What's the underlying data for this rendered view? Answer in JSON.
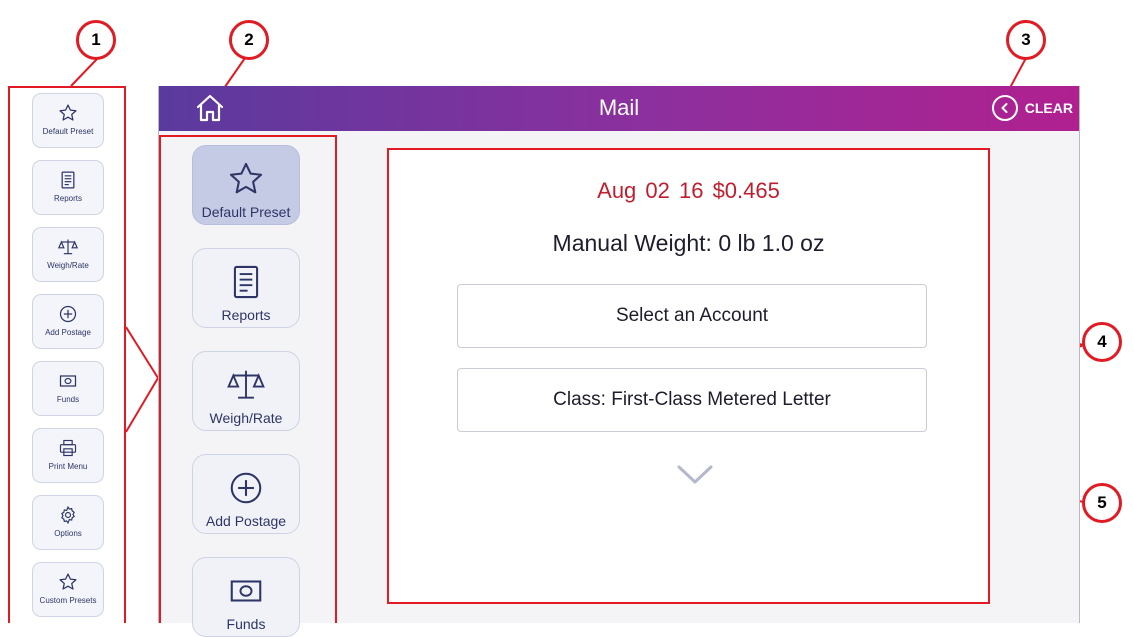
{
  "header": {
    "title": "Mail",
    "clear_label": "CLEAR"
  },
  "small_sidebar": {
    "items": [
      {
        "label": "Default Preset",
        "icon": "star-icon"
      },
      {
        "label": "Reports",
        "icon": "report-icon"
      },
      {
        "label": "Weigh/Rate",
        "icon": "scale-icon"
      },
      {
        "label": "Add Postage",
        "icon": "plus-circle-icon"
      },
      {
        "label": "Funds",
        "icon": "money-icon"
      },
      {
        "label": "Print Menu",
        "icon": "printer-icon"
      },
      {
        "label": "Options",
        "icon": "gear-icon"
      },
      {
        "label": "Custom Presets",
        "icon": "star-icon"
      }
    ]
  },
  "big_sidebar": {
    "items": [
      {
        "label": "Default Preset",
        "icon": "star-icon",
        "active": true
      },
      {
        "label": "Reports",
        "icon": "report-icon"
      },
      {
        "label": "Weigh/Rate",
        "icon": "scale-icon"
      },
      {
        "label": "Add Postage",
        "icon": "plus-circle-icon"
      },
      {
        "label": "Funds",
        "icon": "money-icon"
      }
    ]
  },
  "main": {
    "date_price": "Aug 02 16  $0.465",
    "weight": "Manual Weight: 0 lb 1.0 oz",
    "account_button": "Select an Account",
    "class_button": "Class: First-Class Metered Letter"
  },
  "callouts": [
    "1",
    "2",
    "3",
    "4",
    "5"
  ],
  "colors": {
    "accent_red": "#e01b24",
    "header_start": "#5a3a9e",
    "header_end": "#b0208f",
    "navy": "#2e3566",
    "price_red": "#c01e2f"
  }
}
